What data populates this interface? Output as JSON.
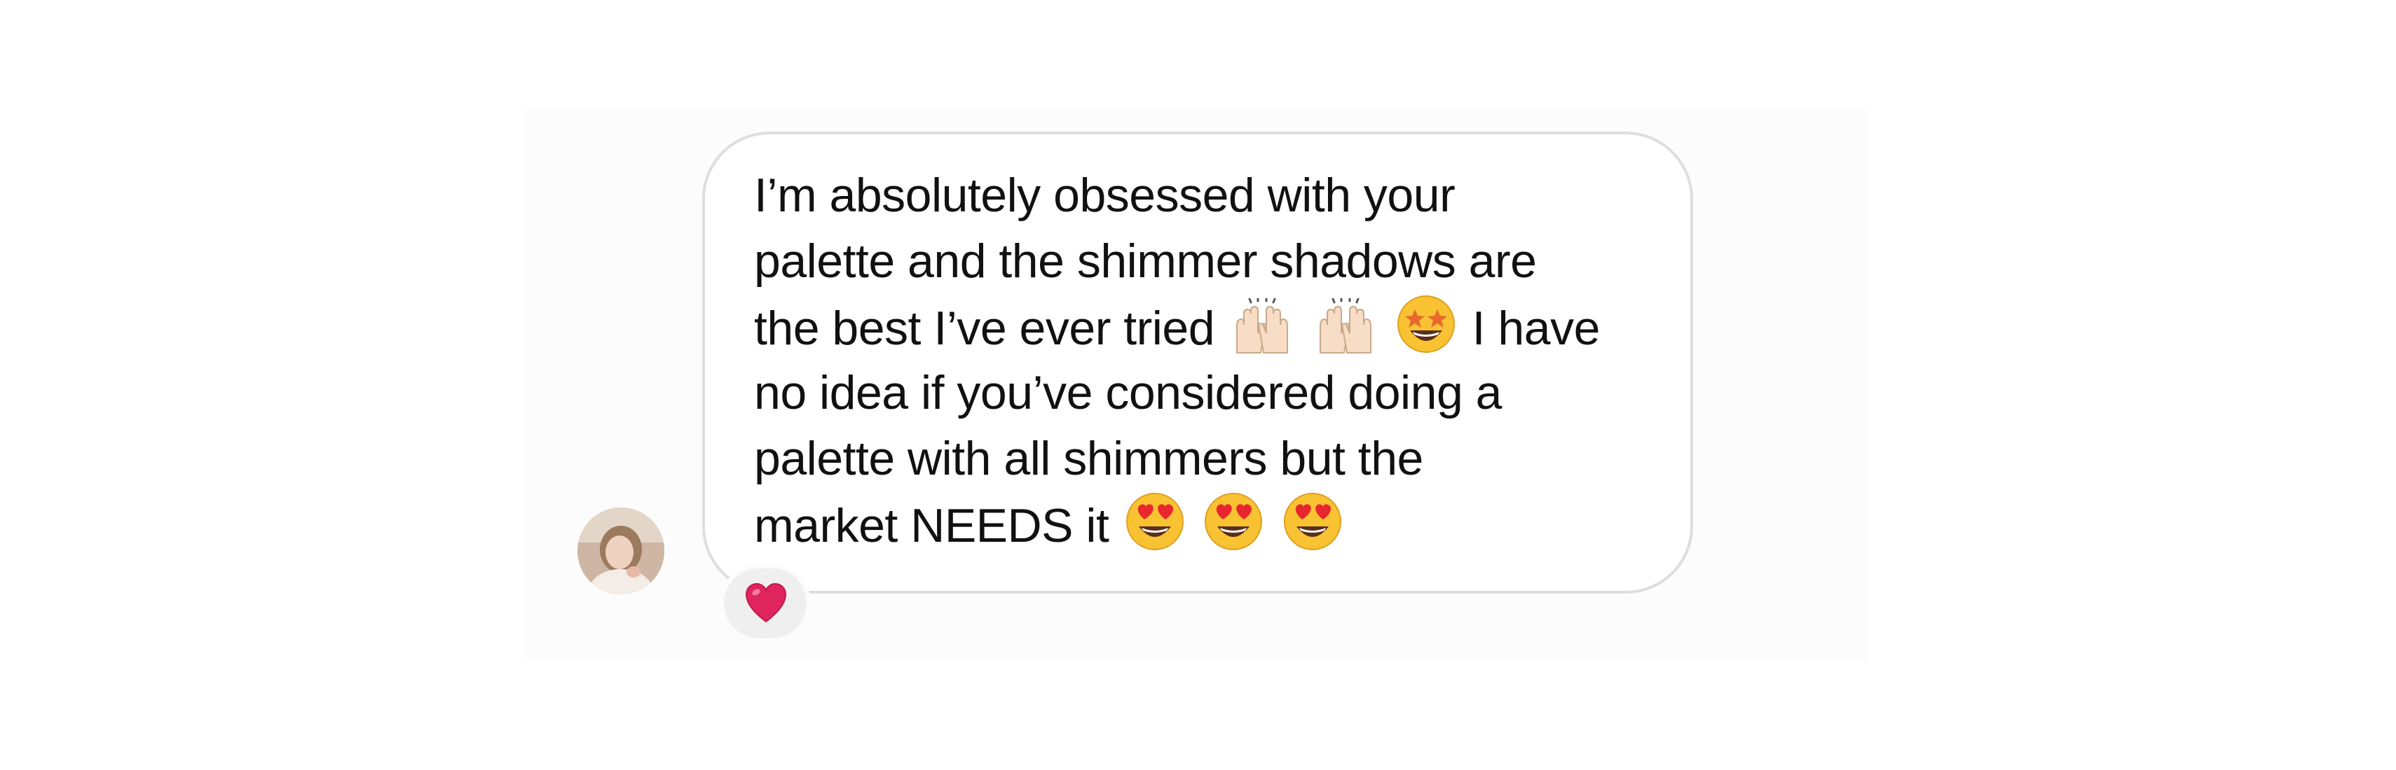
{
  "message": {
    "lines": [
      {
        "text_before": "I’m absolutely obsessed with your",
        "emojis": [],
        "text_after": ""
      },
      {
        "text_before": "palette and the shimmer shadows are",
        "emojis": [],
        "text_after": ""
      },
      {
        "text_before": "the best I’ve ever tried",
        "emojis": [
          "raising-hands-icon",
          "raising-hands-icon",
          "star-struck-icon"
        ],
        "text_after": "I have"
      },
      {
        "text_before": "no idea if you’ve considered doing a",
        "emojis": [],
        "text_after": ""
      },
      {
        "text_before": "palette with all shimmers but the",
        "emojis": [],
        "text_after": ""
      },
      {
        "text_before": "market NEEDS it",
        "emojis": [
          "heart-eyes-icon",
          "heart-eyes-icon",
          "heart-eyes-icon"
        ],
        "text_after": ""
      }
    ]
  },
  "reaction": {
    "icon": "red-heart-icon",
    "color": "#e0245e"
  },
  "avatar": {
    "icon": "profile-photo"
  },
  "colors": {
    "bubble_border": "#dedede",
    "panel_background": "#fcfcfc",
    "reaction_background": "#efefef"
  }
}
